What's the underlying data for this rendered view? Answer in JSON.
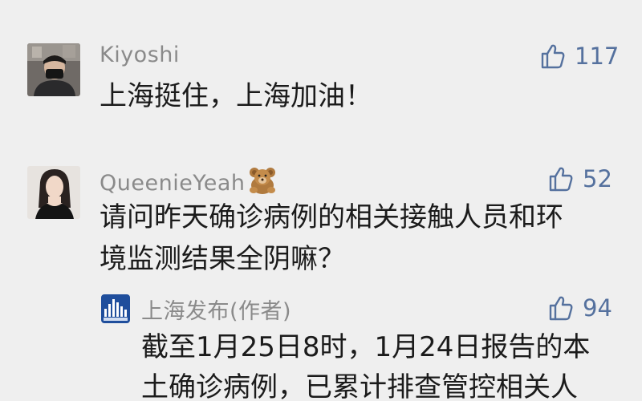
{
  "comments": [
    {
      "author": "Kiyoshi",
      "likes": "117",
      "lines": [
        "上海挺住，上海加油！"
      ]
    },
    {
      "author": "QueenieYeah",
      "author_emoji": "teddy-bear-emoji",
      "likes": "52",
      "lines": [
        "请问昨天确诊病例的相关接触人员和环",
        "境监测结果全阴嘛？"
      ]
    }
  ],
  "reply": {
    "author": "上海发布(作者)",
    "likes": "94",
    "lines": [
      "截至1月25日8时，1月24日报告的本",
      "土确诊病例，已累计排查管控相关人"
    ]
  },
  "icons": {
    "like": "thumbs-up-icon"
  },
  "colors": {
    "background": "#efefef",
    "name": "#8a8a8a",
    "like": "#55719e",
    "text": "#1b1b1b"
  }
}
